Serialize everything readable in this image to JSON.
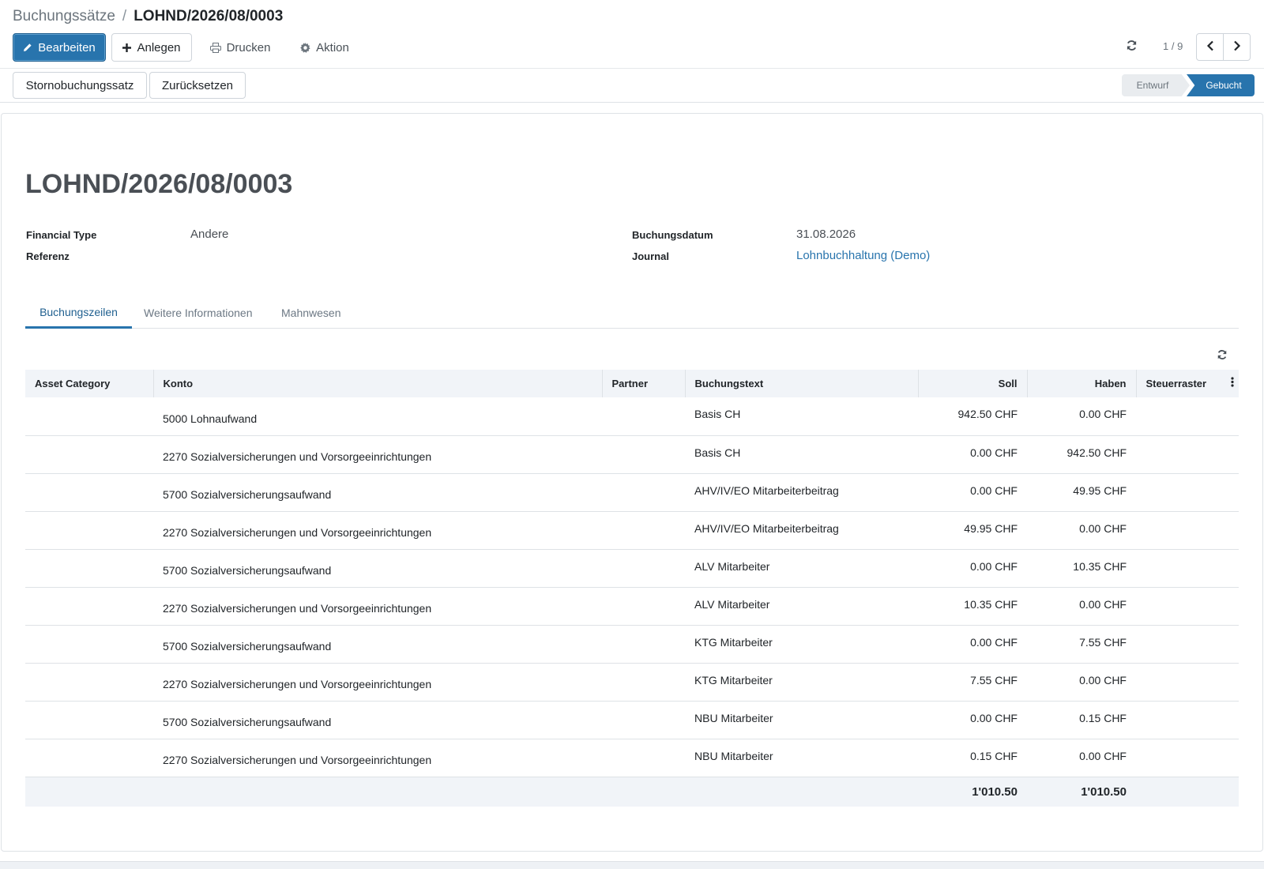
{
  "breadcrumb": {
    "parent": "Buchungssätze",
    "separator": "/",
    "current": "LOHND/2026/08/0003"
  },
  "toolbar": {
    "edit_label": "Bearbeiten",
    "create_label": "Anlegen",
    "print_label": "Drucken",
    "action_label": "Aktion"
  },
  "pager": {
    "value": "1 / 9"
  },
  "status_buttons": {
    "reverse_label": "Stornobuchungssatz",
    "reset_label": "Zurücksetzen"
  },
  "stages": {
    "draft": "Entwurf",
    "posted": "Gebucht"
  },
  "record": {
    "name": "LOHND/2026/08/0003",
    "financial_type_label": "Financial Type",
    "financial_type_value": "Andere",
    "ref_label": "Referenz",
    "ref_value": "",
    "date_label": "Buchungsdatum",
    "date_value": "31.08.2026",
    "journal_label": "Journal",
    "journal_value": "Lohnbuchhaltung (Demo)"
  },
  "tabs": [
    "Buchungszeilen",
    "Weitere Informationen",
    "Mahnwesen"
  ],
  "table": {
    "columns": [
      "Asset Category",
      "Konto",
      "Partner",
      "Buchungstext",
      "Soll",
      "Haben",
      "Steuerraster"
    ],
    "rows": [
      {
        "asset": "",
        "account": "5000 Lohnaufwand",
        "partner": "",
        "label": "Basis CH",
        "debit": "942.50 CHF",
        "credit": "0.00 CHF",
        "tax": ""
      },
      {
        "asset": "",
        "account": "2270 Sozialversicherungen und Vorsorgeeinrichtungen",
        "partner": "",
        "label": "Basis CH",
        "debit": "0.00 CHF",
        "credit": "942.50 CHF",
        "tax": ""
      },
      {
        "asset": "",
        "account": "5700 Sozialversicherungsaufwand",
        "partner": "",
        "label": "AHV/IV/EO Mitarbeiterbeitrag",
        "debit": "0.00 CHF",
        "credit": "49.95 CHF",
        "tax": ""
      },
      {
        "asset": "",
        "account": "2270 Sozialversicherungen und Vorsorgeeinrichtungen",
        "partner": "",
        "label": "AHV/IV/EO Mitarbeiterbeitrag",
        "debit": "49.95 CHF",
        "credit": "0.00 CHF",
        "tax": ""
      },
      {
        "asset": "",
        "account": "5700 Sozialversicherungsaufwand",
        "partner": "",
        "label": "ALV Mitarbeiter",
        "debit": "0.00 CHF",
        "credit": "10.35 CHF",
        "tax": ""
      },
      {
        "asset": "",
        "account": "2270 Sozialversicherungen und Vorsorgeeinrichtungen",
        "partner": "",
        "label": "ALV Mitarbeiter",
        "debit": "10.35 CHF",
        "credit": "0.00 CHF",
        "tax": ""
      },
      {
        "asset": "",
        "account": "5700 Sozialversicherungsaufwand",
        "partner": "",
        "label": "KTG Mitarbeiter",
        "debit": "0.00 CHF",
        "credit": "7.55 CHF",
        "tax": ""
      },
      {
        "asset": "",
        "account": "2270 Sozialversicherungen und Vorsorgeeinrichtungen",
        "partner": "",
        "label": "KTG Mitarbeiter",
        "debit": "7.55 CHF",
        "credit": "0.00 CHF",
        "tax": ""
      },
      {
        "asset": "",
        "account": "5700 Sozialversicherungsaufwand",
        "partner": "",
        "label": "NBU Mitarbeiter",
        "debit": "0.00 CHF",
        "credit": "0.15 CHF",
        "tax": ""
      },
      {
        "asset": "",
        "account": "2270 Sozialversicherungen und Vorsorgeeinrichtungen",
        "partner": "",
        "label": "NBU Mitarbeiter",
        "debit": "0.15 CHF",
        "credit": "0.00 CHF",
        "tax": ""
      }
    ],
    "totals": {
      "debit": "1'010.50",
      "credit": "1'010.50"
    }
  },
  "icons": {
    "edit": "pencil-icon",
    "create": "plus-icon",
    "print": "print-icon",
    "action": "gear-icon",
    "refresh": "refresh-icon",
    "prev": "chevron-left-icon",
    "next": "chevron-right-icon",
    "column_menu": "vertical-dots-icon"
  },
  "colors": {
    "primary": "#2874ad",
    "header_bg": "#f1f4f8",
    "border": "#dee2e6",
    "link": "#2874ad"
  }
}
